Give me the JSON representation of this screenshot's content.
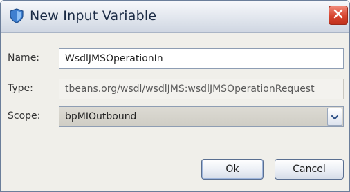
{
  "window": {
    "title": "New Input Variable",
    "icon": "app-shield-icon",
    "close_icon": "close-x-icon"
  },
  "form": {
    "name": {
      "label": "Name:",
      "value": "WsdlJMSOperationIn"
    },
    "type": {
      "label": "Type:",
      "value": "tbeans.org/wsdl/wsdlJMS:wsdlJMSOperationRequest"
    },
    "scope": {
      "label": "Scope:",
      "value": "bpMIOutbound",
      "arrow_icon": "chevron-down-icon"
    }
  },
  "buttons": {
    "ok_label": "Ok",
    "cancel_label": "Cancel"
  },
  "colors": {
    "close_button": "#d6442f",
    "titlebar": "#dfe4ec",
    "dialog_background": "#f0efea"
  }
}
